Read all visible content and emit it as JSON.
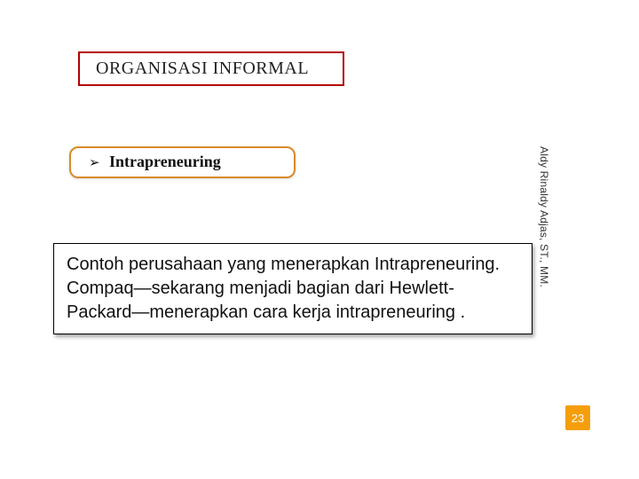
{
  "title": "ORGANISASI INFORMAL",
  "subheading": {
    "bullet": "➢",
    "label": "Intrapreneuring"
  },
  "body_text": "Contoh perusahaan yang menerapkan Intrapreneuring.\nCompaq—sekarang menjadi bagian dari Hewlett-Packard—menerapkan cara kerja intrapreneuring .",
  "author": "Aldy Rinaldy Adjas, ST., MM.",
  "page_number": "23"
}
